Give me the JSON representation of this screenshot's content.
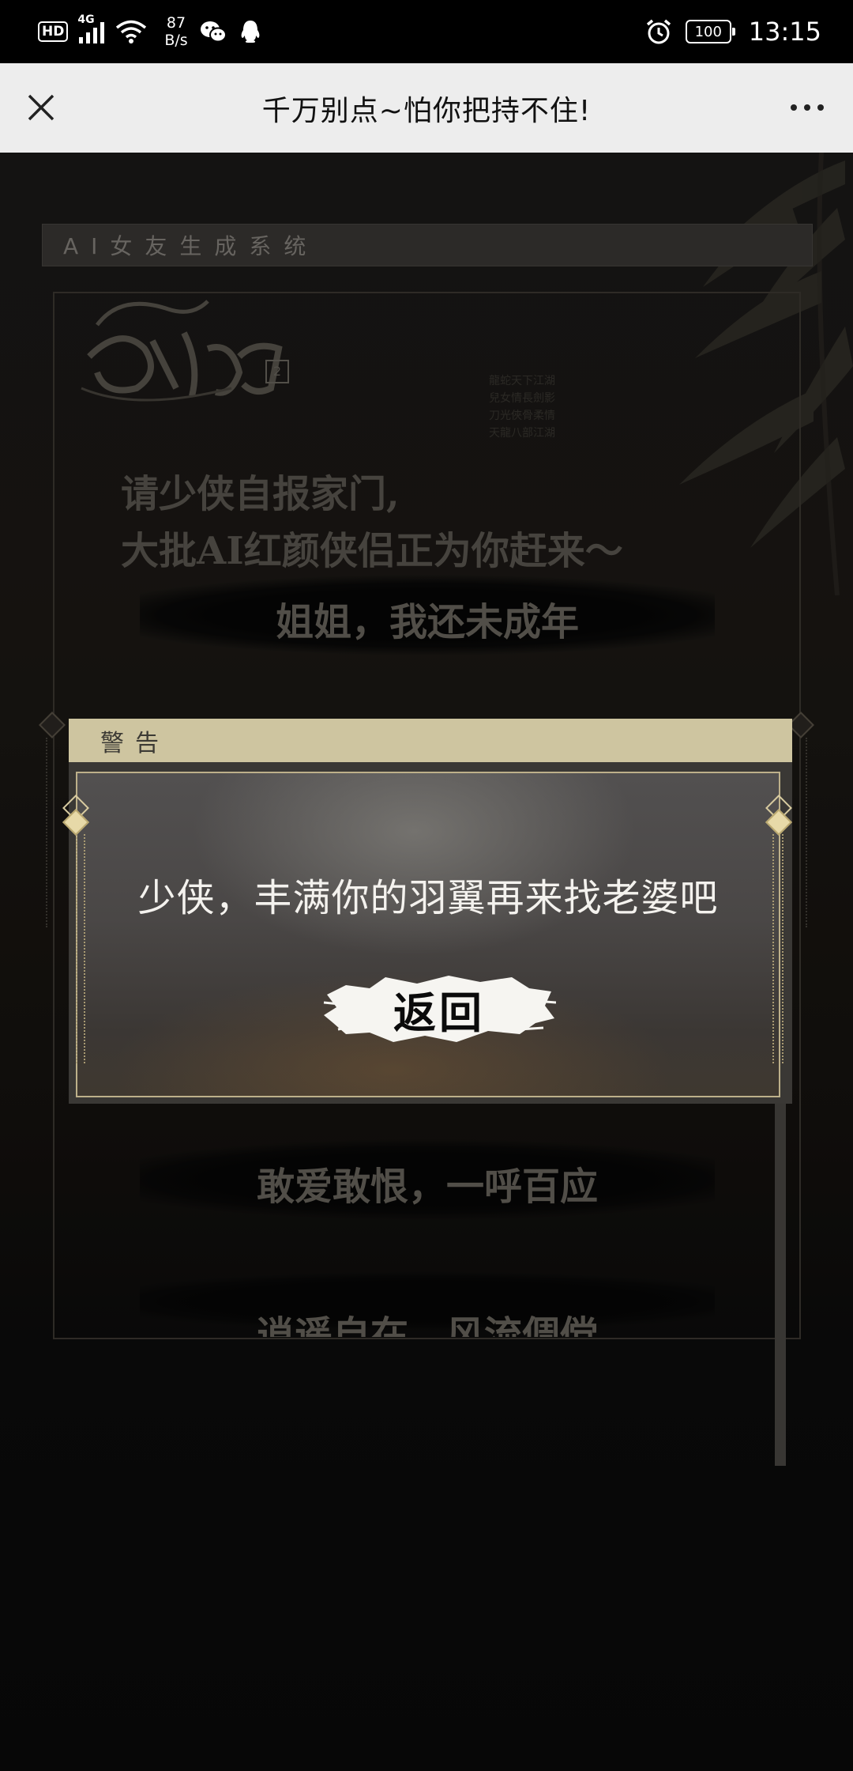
{
  "status_bar": {
    "hd": "HD",
    "network": "4G",
    "speed_value": "87",
    "speed_unit": "B/s",
    "battery": "100",
    "time": "13:15",
    "icons": [
      "signal-icon",
      "wifi-icon",
      "wechat-icon",
      "qq-icon",
      "alarm-icon",
      "battery-icon"
    ]
  },
  "title_bar": {
    "title": "千万别点~怕你把持不住!",
    "close_icon": "close-icon",
    "more_icon": "more-icon"
  },
  "page": {
    "system_header": "AI女友生成系统",
    "logo_text": "天龍八部",
    "logo_seal": "2",
    "intro_line1": "请少侠自报家门,",
    "intro_line2": "大批AI红颜侠侣正为你赶来～",
    "options": [
      "姐姐，我还未成年",
      "敢爱敢恨，一呼百应",
      "逍遥自在，风流倜傥"
    ]
  },
  "dialog": {
    "title": "警告",
    "message": "少侠，丰满你的羽翼再来找老婆吧",
    "button_label": "返回"
  },
  "colors": {
    "title_bar_bg": "#ededed",
    "dialog_header_bg": "#cec5a0",
    "dialog_border": "#bdb08a",
    "accent_gold": "#e7d9a8"
  }
}
